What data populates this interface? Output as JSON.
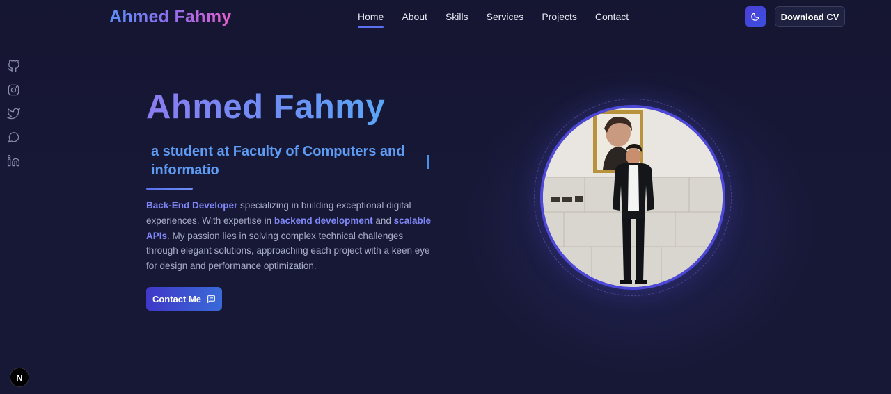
{
  "header": {
    "logo": "Ahmed Fahmy",
    "nav": [
      {
        "label": "Home",
        "active": true
      },
      {
        "label": "About"
      },
      {
        "label": "Skills"
      },
      {
        "label": "Services"
      },
      {
        "label": "Projects"
      },
      {
        "label": "Contact"
      }
    ],
    "theme_icon": "moon-icon",
    "download_cv": "Download CV"
  },
  "socials": [
    "github-icon",
    "instagram-icon",
    "twitter-icon",
    "chat-icon",
    "linkedin-icon"
  ],
  "hero": {
    "name": "Ahmed Fahmy",
    "typed_text": "a student at Faculty of Computers and informatio",
    "bio": {
      "role": "Back-End Developer",
      "text1": " specializing in building exceptional digital experiences. With expertise in ",
      "hl1": "backend development",
      "text2": " and ",
      "hl2": "scalable APIs",
      "text3": ". My passion lies in solving complex technical challenges through elegant solutions, approaching each project with a keen eye for design and performance optimization."
    },
    "contact_button": "Contact Me"
  },
  "colors": {
    "background": "#171836",
    "accent": "#4d48d8",
    "highlight": "#7f86f5"
  },
  "badge": "N"
}
